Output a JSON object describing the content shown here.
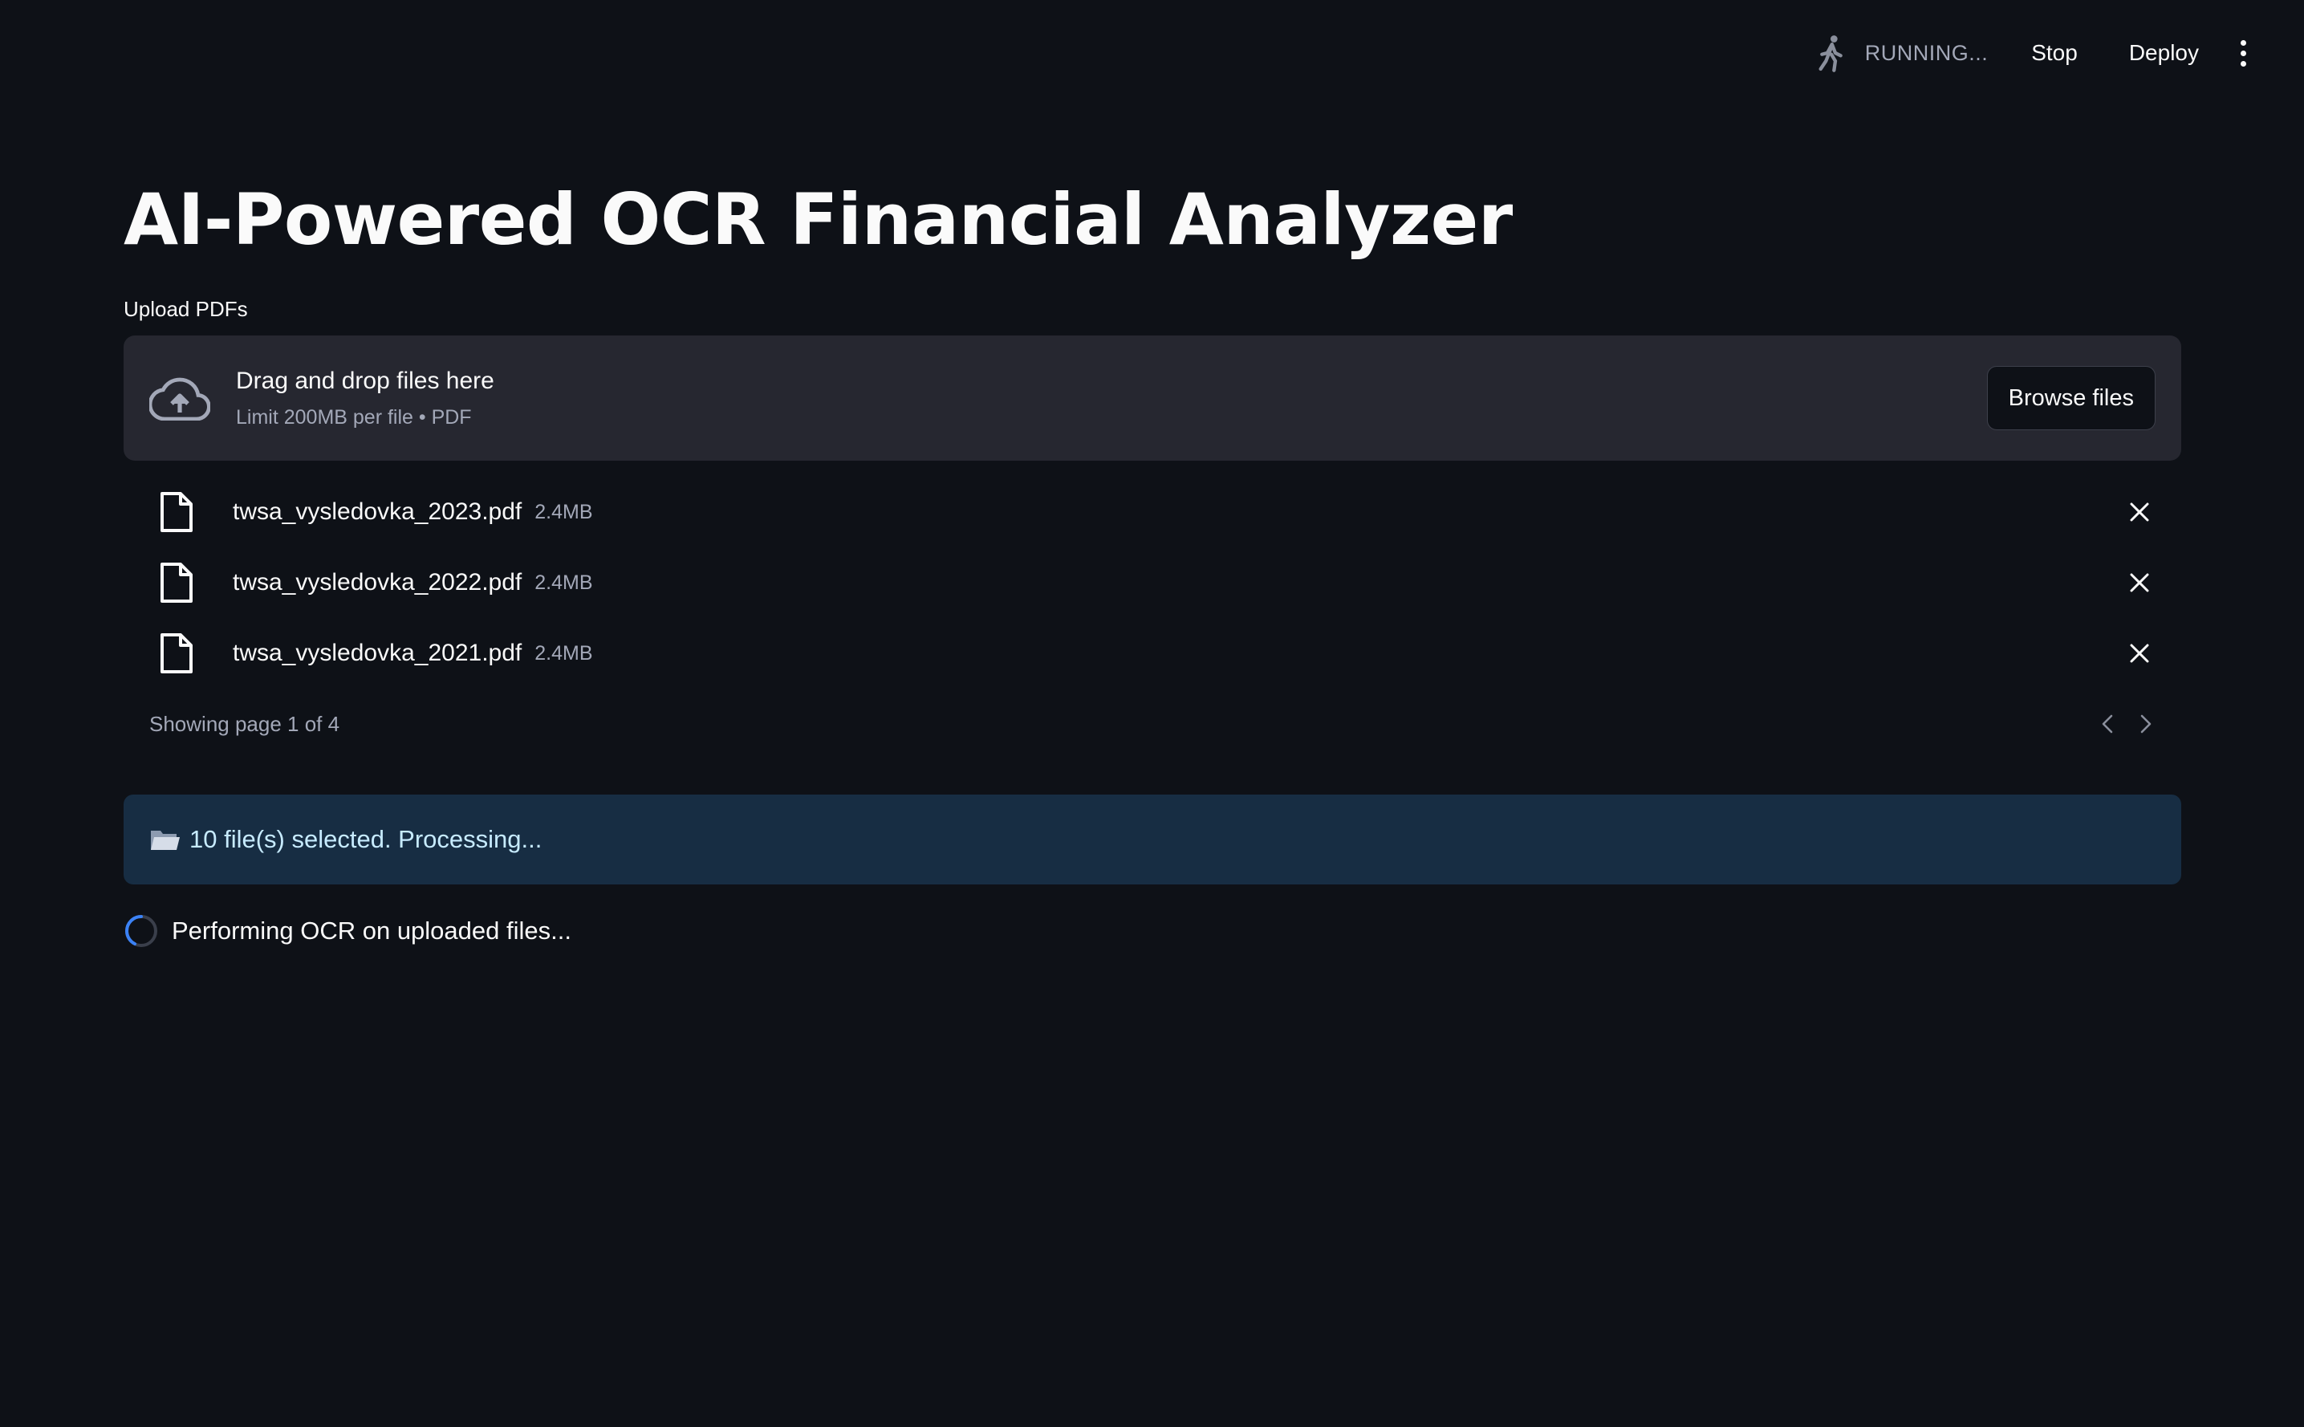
{
  "header": {
    "status_text": "RUNNING...",
    "stop_label": "Stop",
    "deploy_label": "Deploy",
    "status_icon": "running-person-icon",
    "menu_icon": "kebab-menu-icon"
  },
  "main": {
    "title": "AI-Powered OCR Financial Analyzer",
    "uploader": {
      "label": "Upload PDFs",
      "drop_text": "Drag and drop files here",
      "limit_text": "Limit 200MB per file • PDF",
      "browse_label": "Browse files",
      "icon": "cloud-upload-icon"
    },
    "files": [
      {
        "name": "twsa_vysledovka_2023.pdf",
        "size": "2.4MB"
      },
      {
        "name": "twsa_vysledovka_2022.pdf",
        "size": "2.4MB"
      },
      {
        "name": "twsa_vysledovka_2021.pdf",
        "size": "2.4MB"
      }
    ],
    "pagination": {
      "text": "Showing page 1 of 4"
    },
    "info": {
      "text": "10 file(s) selected. Processing...",
      "icon": "folder-icon"
    },
    "spinner": {
      "text": "Performing OCR on uploaded files..."
    }
  },
  "colors": {
    "background": "#0e1117",
    "dropzone": "#262730",
    "info_bg": "#172d43",
    "info_text": "#c7ebff",
    "muted_text": "#a3a8b8",
    "spinner_accent": "#3b82f6"
  }
}
